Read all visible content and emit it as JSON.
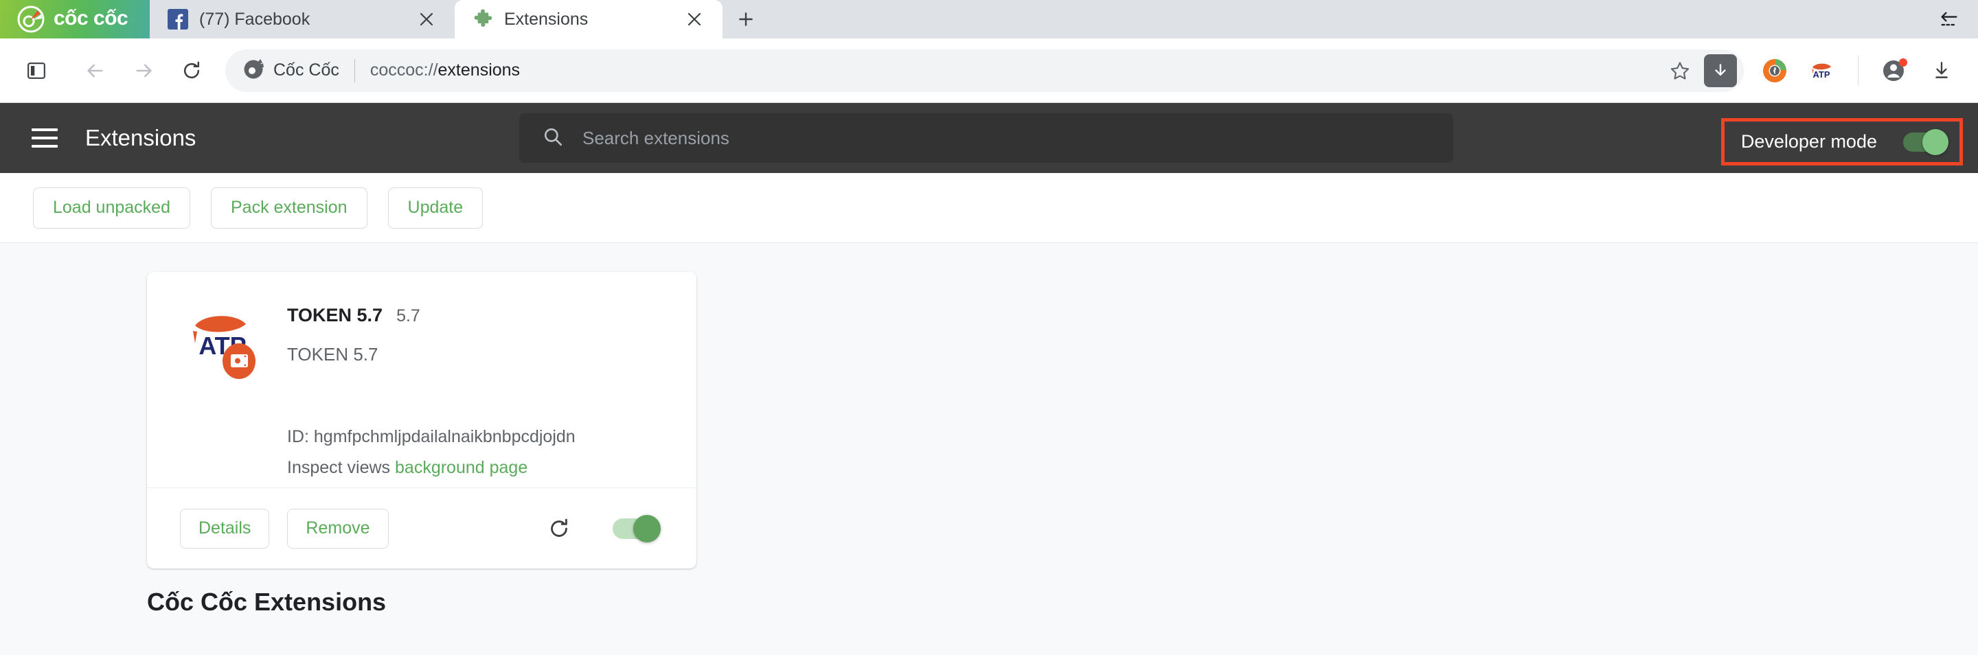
{
  "window": {
    "restore_icon": "collapse-left-arrow-icon"
  },
  "brand": {
    "name": "cốc cốc",
    "logo_icon": "coccoc-logo-icon"
  },
  "tabs": [
    {
      "title": "(77) Facebook",
      "favicon": "facebook-icon",
      "active": false,
      "close_icon": "close-icon"
    },
    {
      "title": "Extensions",
      "favicon": "puzzle-piece-icon",
      "active": true,
      "close_icon": "close-icon"
    }
  ],
  "new_tab": {
    "label": "+",
    "icon": "plus-icon"
  },
  "toolbar": {
    "sidebar_icon": "sidebar-panel-icon",
    "back_icon": "arrow-left-icon",
    "forward_icon": "arrow-right-icon",
    "reload_icon": "reload-icon",
    "omnibox": {
      "brand_text": "Cốc Cốc",
      "brand_icon": "coccoc-mark-icon",
      "url_scheme": "coccoc://",
      "url_path": "extensions",
      "bookmark_icon": "star-icon",
      "download_icon": "download-arrow-icon"
    },
    "extension_icons": [
      {
        "name": "coin-donut-extension-icon"
      },
      {
        "name": "atp-extension-icon"
      }
    ],
    "profile_icon": "account-avatar-icon",
    "profile_badge": "notification-dot",
    "downloads_icon": "downloads-tray-icon"
  },
  "ext_header": {
    "menu_icon": "hamburger-menu-icon",
    "title": "Extensions",
    "search": {
      "icon": "search-icon",
      "placeholder": "Search extensions",
      "value": ""
    },
    "developer_mode": {
      "label": "Developer mode",
      "enabled": true,
      "highlight_color": "#f04524"
    }
  },
  "dev_toolbar": {
    "buttons": [
      {
        "label": "Load unpacked",
        "name": "load-unpacked-button"
      },
      {
        "label": "Pack extension",
        "name": "pack-extension-button"
      },
      {
        "label": "Update",
        "name": "update-button"
      }
    ]
  },
  "extension_card": {
    "icon": "atp-token-extension-icon",
    "title": "TOKEN 5.7",
    "version": "5.7",
    "description": "TOKEN 5.7",
    "id_label": "ID: hgmfpchmljpdailalnaikbnbpcdjojdn",
    "inspect_label": "Inspect views",
    "inspect_link": "background page",
    "details_label": "Details",
    "remove_label": "Remove",
    "reload_icon": "reload-icon",
    "enabled": true
  },
  "section": {
    "title": "Cốc Cốc Extensions"
  },
  "colors": {
    "brand_green": "#5aab5a",
    "header_dark": "#3c3c3c",
    "search_dark": "#333333",
    "page_bg": "#f8f9fa",
    "highlight_red": "#f04524",
    "toggle_on": "#81c784"
  }
}
